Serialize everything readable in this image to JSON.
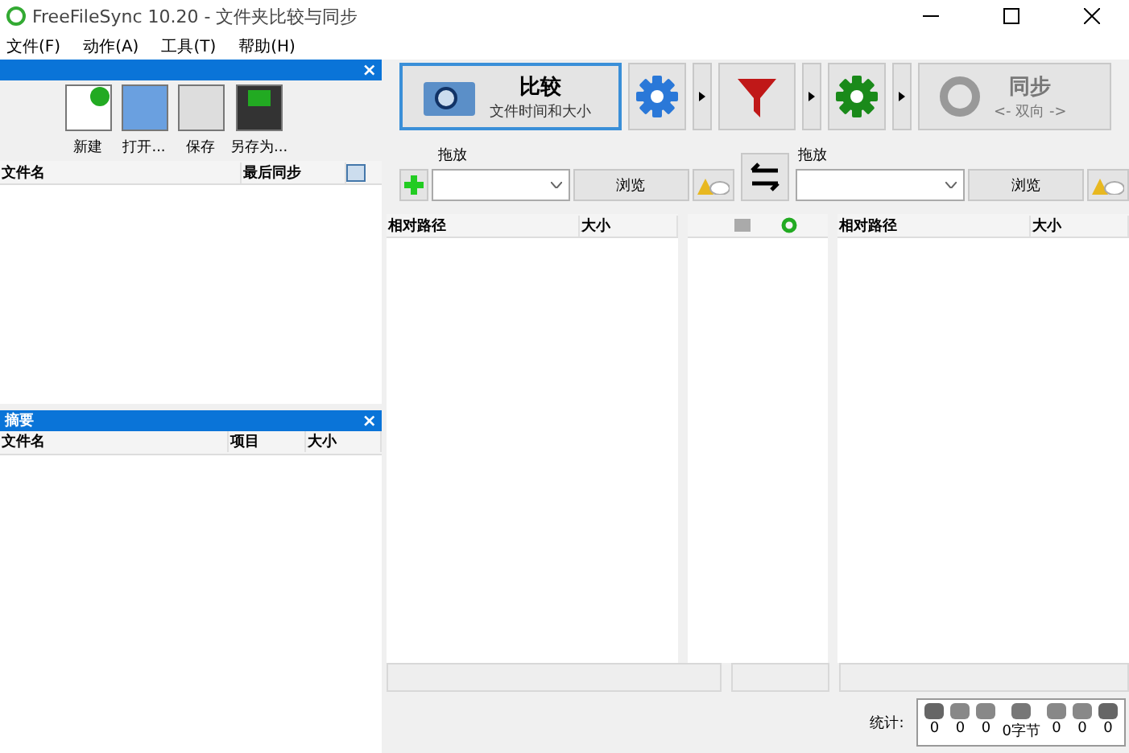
{
  "window": {
    "title": "FreeFileSync 10.20 - 文件夹比较与同步"
  },
  "menu": [
    "文件(F)",
    "动作(A)",
    "工具(T)",
    "帮助(H)"
  ],
  "config_panel": {
    "close": "×",
    "buttons": [
      {
        "kind": "new",
        "label": "新建"
      },
      {
        "kind": "open",
        "label": "打开..."
      },
      {
        "kind": "save",
        "label": "保存"
      },
      {
        "kind": "saveas",
        "label": "另存为..."
      }
    ],
    "columns": [
      "文件名",
      "最后同步"
    ]
  },
  "summary_panel": {
    "title": "摘要",
    "close": "×",
    "columns": [
      "文件名",
      "项目",
      "大小"
    ]
  },
  "compare": {
    "title": "比较",
    "subtitle": "文件时间和大小"
  },
  "sync": {
    "title": "同步",
    "subtitle": "<- 双向 ->"
  },
  "folders": [
    {
      "label": "拖放",
      "button": "浏览"
    },
    {
      "label": "拖放",
      "button": "浏览"
    }
  ],
  "grid": {
    "left_columns": [
      "相对路径",
      "大小"
    ],
    "right_columns": [
      "相对路径",
      "大小"
    ]
  },
  "stats": {
    "label": "统计:",
    "items": [
      {
        "kind": "create-left",
        "value": "0"
      },
      {
        "kind": "update-left",
        "value": "0"
      },
      {
        "kind": "delete-left",
        "value": "0"
      },
      {
        "kind": "bytes",
        "value": "0字节"
      },
      {
        "kind": "delete-right",
        "value": "0"
      },
      {
        "kind": "update-right",
        "value": "0"
      },
      {
        "kind": "create-right",
        "value": "0"
      }
    ]
  }
}
